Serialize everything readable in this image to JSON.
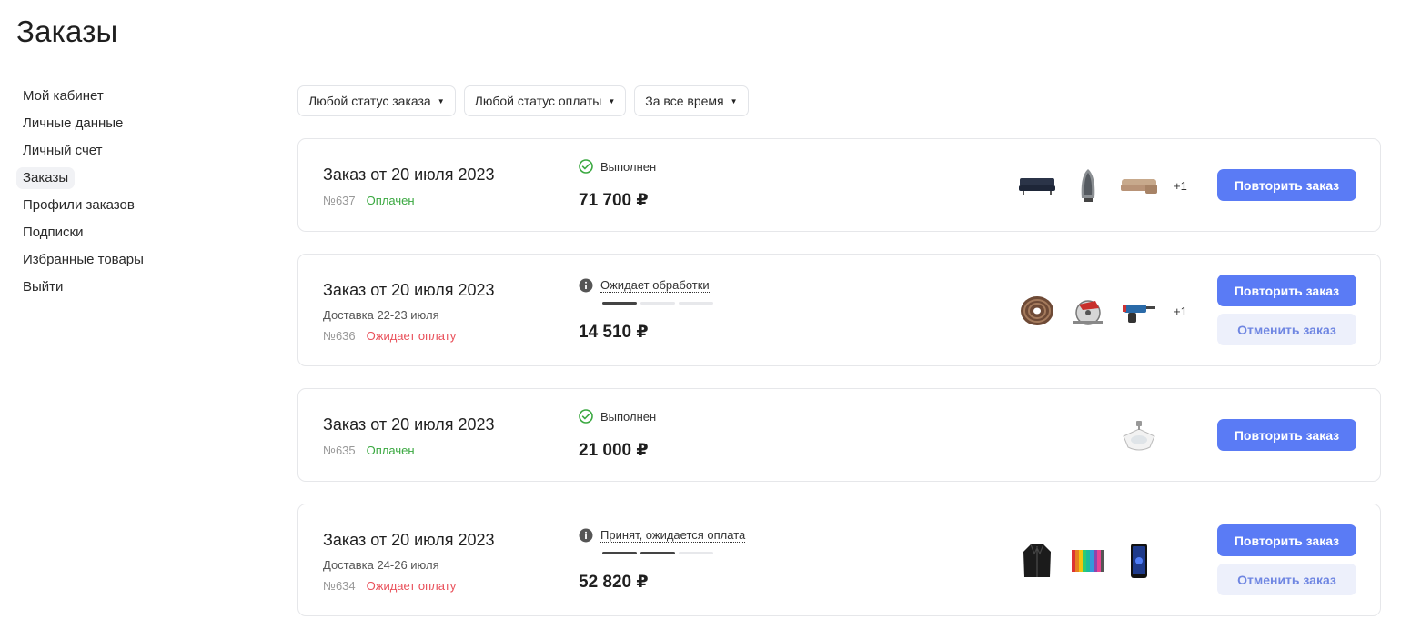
{
  "page": {
    "title": "Заказы"
  },
  "sidebar": {
    "items": [
      {
        "label": "Мой кабинет"
      },
      {
        "label": "Личные данные"
      },
      {
        "label": "Личный счет"
      },
      {
        "label": "Заказы",
        "active": true
      },
      {
        "label": "Профили заказов"
      },
      {
        "label": "Подписки"
      },
      {
        "label": "Избранные товары"
      },
      {
        "label": "Выйти"
      }
    ]
  },
  "filters": {
    "order_status": "Любой статус заказа",
    "payment_status": "Любой статус оплаты",
    "period": "За все время"
  },
  "orders": [
    {
      "title": "Заказ от 20 июля 2023",
      "number": "№637",
      "payment": "Оплачен",
      "status": "Выполнен",
      "sum": "71 700 ₽",
      "more": "+1",
      "repeat": "Повторить заказ"
    },
    {
      "title": "Заказ от 20 июля 2023",
      "delivery": "Доставка 22-23 июля",
      "number": "№636",
      "payment": "Ожидает оплату",
      "status": "Ожидает обработки",
      "progress": 1,
      "sum": "14 510 ₽",
      "more": "+1",
      "repeat": "Повторить заказ",
      "cancel": "Отменить заказ"
    },
    {
      "title": "Заказ от 20 июля 2023",
      "number": "№635",
      "payment": "Оплачен",
      "status": "Выполнен",
      "sum": "21 000 ₽",
      "repeat": "Повторить заказ"
    },
    {
      "title": "Заказ от 20 июля 2023",
      "delivery": "Доставка 24-26 июля",
      "number": "№634",
      "payment": "Ожидает оплату",
      "status": "Принят, ожидается оплата",
      "progress": 2,
      "sum": "52 820 ₽",
      "repeat": "Повторить заказ",
      "cancel": "Отменить заказ"
    }
  ],
  "colors": {
    "accent": "#5a7bf5",
    "paid": "#3aa840",
    "awaiting": "#e9505a",
    "done_icon": "#3aa840",
    "info_icon": "#555555"
  }
}
